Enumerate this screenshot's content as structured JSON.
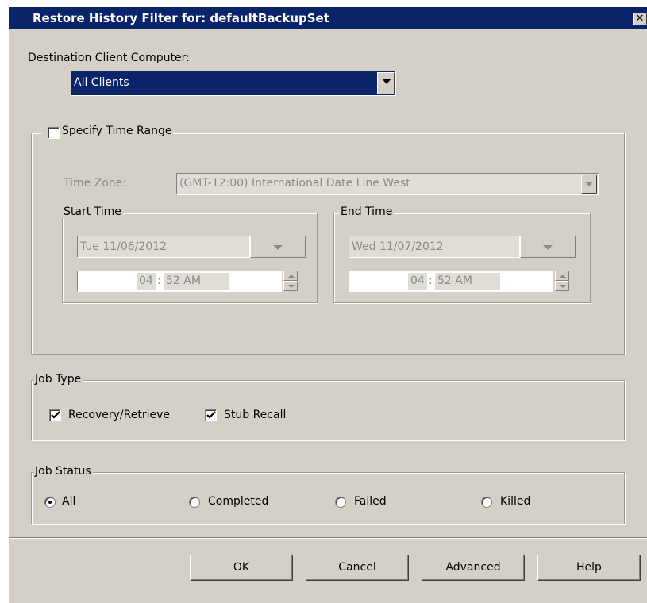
{
  "window": {
    "title": "Restore History Filter for: defaultBackupSet",
    "close_glyph": "✕"
  },
  "destination": {
    "label": "Destination Client Computer:",
    "value": "All Clients"
  },
  "time_range": {
    "checkbox_label": "Specify Time Range",
    "checked": false,
    "time_zone_label": "Time Zone:",
    "time_zone_value": "(GMT-12:00) International Date Line West",
    "start": {
      "label": "Start Time",
      "date": "Tue 11/06/2012",
      "hour": "04",
      "sep": ":",
      "minute": "52 AM"
    },
    "end": {
      "label": "End Time",
      "date": "Wed 11/07/2012",
      "hour": "04",
      "sep": ":",
      "minute": "52 AM"
    }
  },
  "job_type": {
    "label": "Job Type",
    "options": [
      {
        "label": "Recovery/Retrieve",
        "checked": true
      },
      {
        "label": "Stub Recall",
        "checked": true
      }
    ]
  },
  "job_status": {
    "label": "Job Status",
    "options": [
      {
        "label": "All",
        "selected": true
      },
      {
        "label": "Completed",
        "selected": false
      },
      {
        "label": "Failed",
        "selected": false
      },
      {
        "label": "Killed",
        "selected": false
      }
    ]
  },
  "buttons": {
    "ok": "OK",
    "cancel": "Cancel",
    "advanced": "Advanced",
    "help": "Help"
  },
  "colors": {
    "title_bar": "#0a246a",
    "dialog_face": "#d4d0c8",
    "selection": "#0a246a"
  }
}
